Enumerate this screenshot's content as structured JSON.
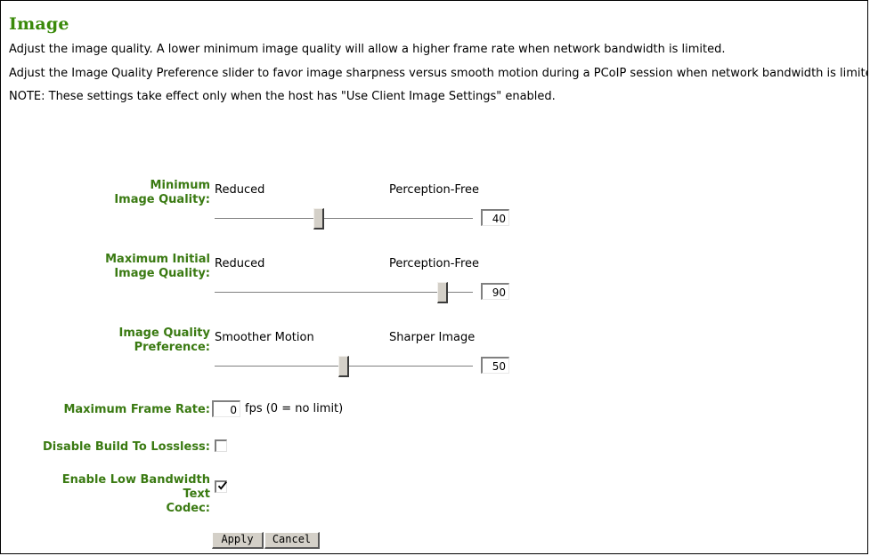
{
  "page": {
    "title": "Image",
    "intro_lines": [
      "Adjust the image quality. A lower minimum image quality will allow a higher frame rate when network bandwidth is limited.",
      "Adjust the Image Quality Preference slider to favor image sharpness versus smooth motion during a PCoIP session when network bandwidth is limited.",
      "NOTE: These settings take effect only when the host has \"Use Client Image Settings\" enabled."
    ],
    "heading_color": "#3a8a0a",
    "label_color": "#3a7a12"
  },
  "sliders": [
    {
      "label": "Minimum\nImage Quality:",
      "left_cap": "Reduced",
      "right_cap": "Perception-Free",
      "value": "40",
      "min": 0,
      "max": 100
    },
    {
      "label": "Maximum Initial\nImage Quality:",
      "left_cap": "Reduced",
      "right_cap": "Perception-Free",
      "value": "90",
      "min": 0,
      "max": 100
    },
    {
      "label": "Image Quality\nPreference:",
      "left_cap": "Smoother Motion",
      "right_cap": "Sharper Image",
      "value": "50",
      "min": 0,
      "max": 100
    }
  ],
  "frame_rate": {
    "label": "Maximum Frame Rate:",
    "value": "0",
    "suffix": "fps (0 = no limit)"
  },
  "checkboxes": [
    {
      "label": "Disable Build To Lossless:",
      "checked": false
    },
    {
      "label": "Enable Low Bandwidth Text\nCodec:",
      "checked": true
    }
  ],
  "buttons": {
    "apply": "Apply",
    "cancel": "Cancel"
  }
}
